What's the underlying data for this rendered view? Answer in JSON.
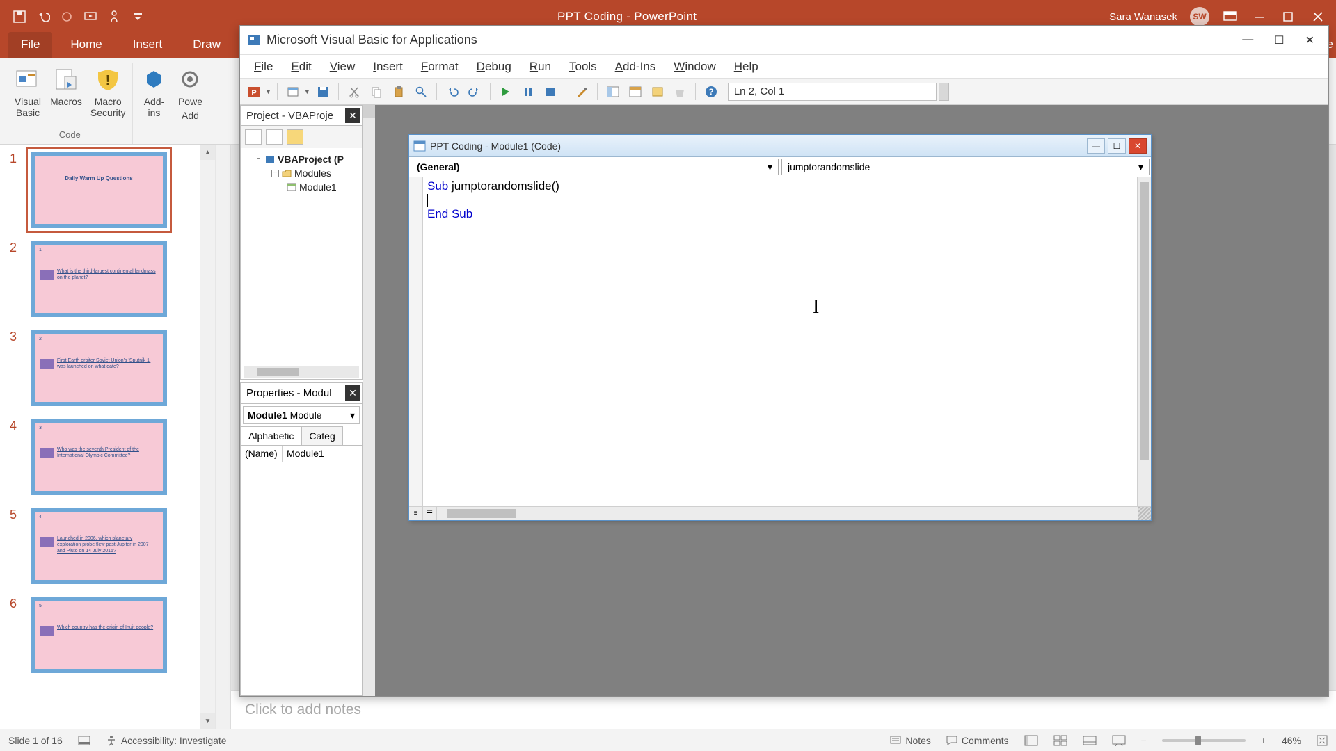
{
  "app": {
    "title": "PPT Coding  -  PowerPoint",
    "user": "Sara Wanasek",
    "avatar": "SW"
  },
  "ribbon_tabs": {
    "file": "File",
    "home": "Home",
    "insert": "Insert",
    "draw": "Draw",
    "share_tail": "are"
  },
  "ribbon": {
    "group_code": "Code",
    "visual_basic": "Visual\nBasic",
    "macros": "Macros",
    "macro_security": "Macro\nSecurity",
    "addins": "Add-\nins",
    "power": "Powe",
    "addx": "Add"
  },
  "thumbs": {
    "items": [
      {
        "n": "1",
        "title": "Daily Warm Up Questions"
      },
      {
        "n": "2",
        "corner": "1",
        "txt": "What is the third-largest continental landmass on the planet?"
      },
      {
        "n": "3",
        "corner": "2",
        "txt": "First Earth orbiter Soviet Union's 'Sputnik 1' was launched on what date?"
      },
      {
        "n": "4",
        "corner": "3",
        "txt": "Who was the seventh President of the International Olympic Committee?"
      },
      {
        "n": "5",
        "corner": "4",
        "txt": "Launched in 2006, which planetary exploration probe flew past Jupiter in 2007 and Pluto on 14 July 2015?"
      },
      {
        "n": "6",
        "corner": "5",
        "txt": "Which country has the origin of Inuit people?"
      }
    ]
  },
  "notes_placeholder": "Click to add notes",
  "status": {
    "slide": "Slide 1 of 16",
    "accessibility": "Accessibility: Investigate",
    "notes": "Notes",
    "comments": "Comments",
    "zoom": "46%"
  },
  "vba": {
    "title": "Microsoft Visual Basic for Applications",
    "menus": [
      "File",
      "Edit",
      "View",
      "Insert",
      "Format",
      "Debug",
      "Run",
      "Tools",
      "Add-Ins",
      "Window",
      "Help"
    ],
    "cursor_pos": "Ln 2, Col 1",
    "project_title": "Project - VBAProje",
    "tree": {
      "root": "VBAProject (P",
      "modules": "Modules",
      "module1": "Module1"
    },
    "props_title": "Properties - Modul",
    "props_select_bold": "Module1",
    "props_select_rest": " Module",
    "props_tab_alpha": "Alphabetic",
    "props_tab_cat": "Categ",
    "props_name_k": "(Name)",
    "props_name_v": "Module1",
    "code_title": "PPT Coding - Module1 (Code)",
    "sel_general": "(General)",
    "sel_proc": "jumptorandomslide",
    "code_line1a": "Sub ",
    "code_line1b": "jumptorandomslide()",
    "code_line3": "End Sub"
  }
}
